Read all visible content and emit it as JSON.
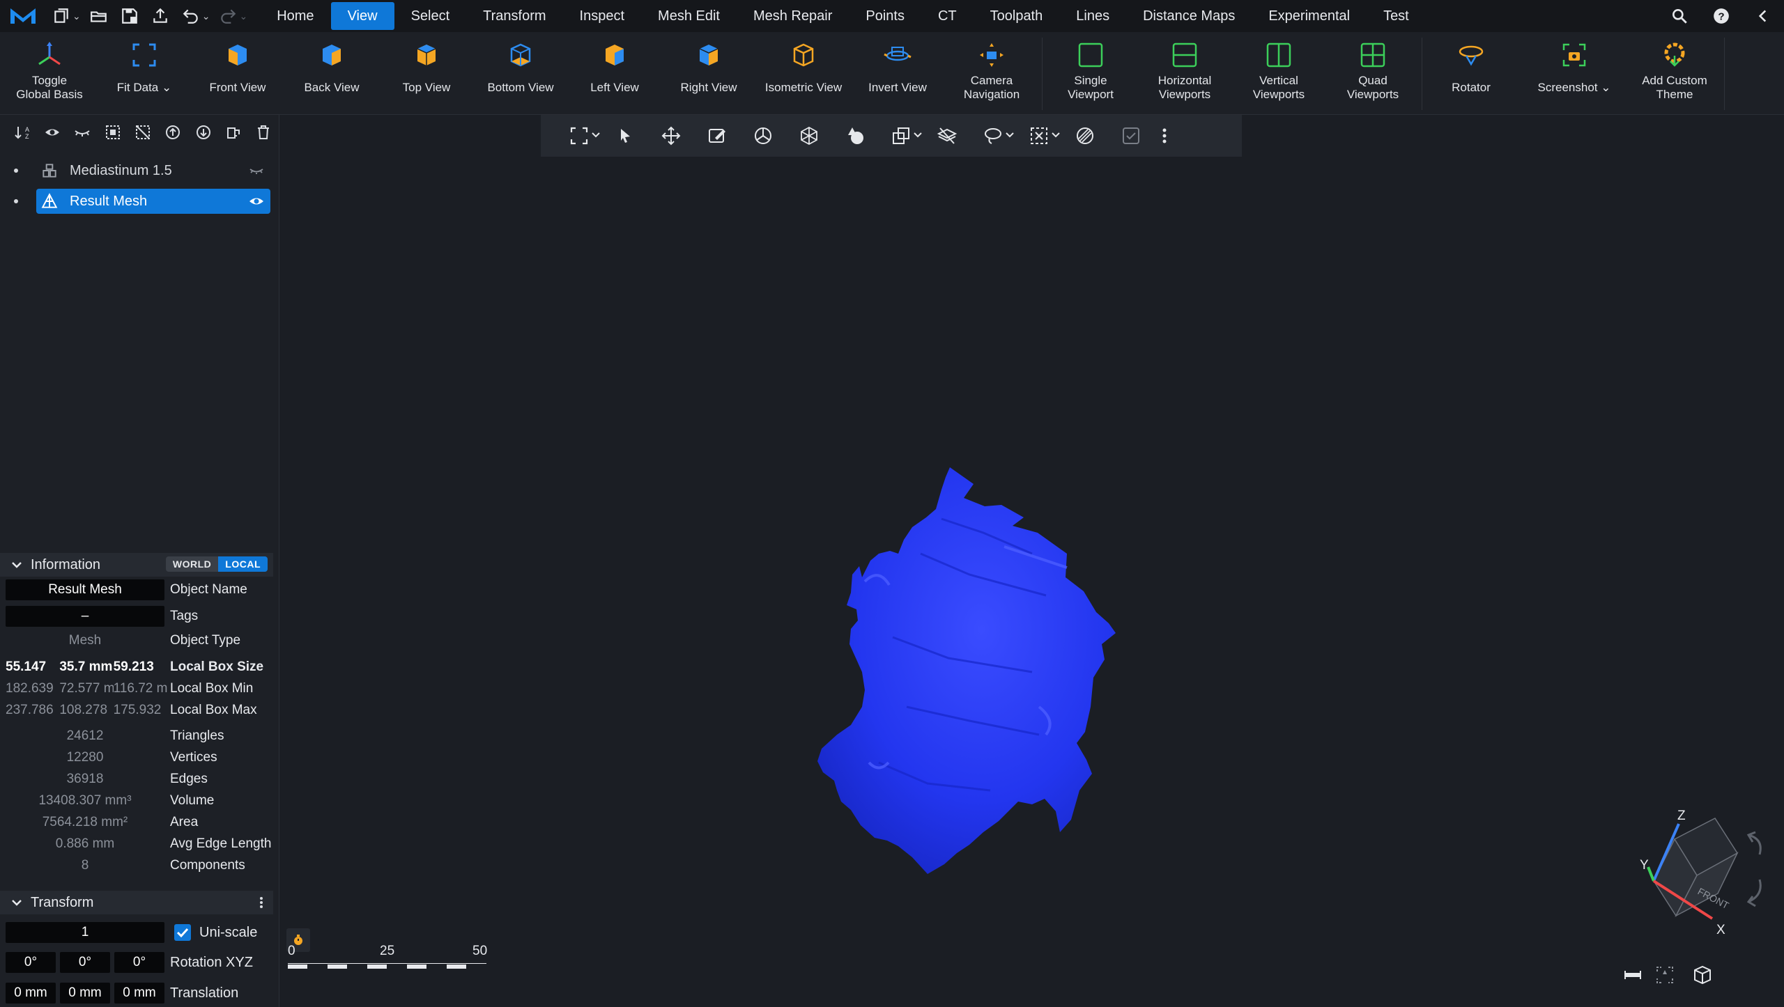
{
  "menubar": {
    "tabs": [
      {
        "label": "Home",
        "active": false
      },
      {
        "label": "View",
        "active": true
      },
      {
        "label": "Select",
        "active": false
      },
      {
        "label": "Transform",
        "active": false
      },
      {
        "label": "Inspect",
        "active": false
      },
      {
        "label": "Mesh Edit",
        "active": false
      },
      {
        "label": "Mesh Repair",
        "active": false
      },
      {
        "label": "Points",
        "active": false
      },
      {
        "label": "CT",
        "active": false
      },
      {
        "label": "Toolpath",
        "active": false
      },
      {
        "label": "Lines",
        "active": false
      },
      {
        "label": "Distance Maps",
        "active": false
      },
      {
        "label": "Experimental",
        "active": false
      },
      {
        "label": "Test",
        "active": false
      }
    ],
    "accent": "#0f78d8"
  },
  "ribbon": {
    "toggle_global_basis": "Toggle\nGlobal Basis",
    "fit_data": "Fit Data",
    "front_view": "Front View",
    "back_view": "Back View",
    "top_view": "Top View",
    "bottom_view": "Bottom View",
    "left_view": "Left View",
    "right_view": "Right View",
    "isometric_view": "Isometric View",
    "invert_view": "Invert View",
    "camera_navigation": "Camera\nNavigation",
    "single_viewport": "Single\nViewport",
    "horizontal_viewports": "Horizontal\nViewports",
    "vertical_viewports": "Vertical\nViewports",
    "quad_viewports": "Quad\nViewports",
    "rotator": "Rotator",
    "screenshot": "Screenshot",
    "add_custom_theme": "Add Custom\nTheme"
  },
  "tree": {
    "items": [
      {
        "name": "Mediastinum 1.5",
        "selected": false,
        "visible": false
      },
      {
        "name": "Result Mesh",
        "selected": true,
        "visible": true
      }
    ]
  },
  "information": {
    "title": "Information",
    "world": "WORLD",
    "local": "LOCAL",
    "object_name_value": "Result Mesh",
    "object_name_label": "Object Name",
    "tags_value": "–",
    "tags_label": "Tags",
    "object_type_value": "Mesh",
    "object_type_label": "Object Type",
    "box_size": [
      "55.147",
      "35.7 mm",
      "59.213"
    ],
    "box_size_label": "Local Box Size",
    "box_min": [
      "182.639",
      "72.577 mm",
      "116.72 mm"
    ],
    "box_min_label": "Local Box Min",
    "box_max": [
      "237.786",
      "108.278",
      "175.932"
    ],
    "box_max_label": "Local Box Max",
    "triangles_value": "24612",
    "triangles_label": "Triangles",
    "vertices_value": "12280",
    "vertices_label": "Vertices",
    "edges_value": "36918",
    "edges_label": "Edges",
    "volume_value": "13408.307 mm³",
    "volume_label": "Volume",
    "area_value": "7564.218 mm²",
    "area_label": "Area",
    "avg_edge_value": "0.886 mm",
    "avg_edge_label": "Avg Edge Length",
    "components_value": "8",
    "components_label": "Components"
  },
  "transform": {
    "title": "Transform",
    "scale_value": "1",
    "uniscale_label": "Uni-scale",
    "rotation": [
      "0°",
      "0°",
      "0°"
    ],
    "rotation_label": "Rotation XYZ",
    "translation": [
      "0 mm",
      "0 mm",
      "0 mm"
    ],
    "translation_label": "Translation"
  },
  "viewport": {
    "mesh_color": "#2a3cff",
    "scale_labels": [
      "0",
      "25",
      "50"
    ],
    "axis": {
      "z": "Z",
      "y": "Y",
      "x": "X",
      "face": "FRONT"
    }
  }
}
